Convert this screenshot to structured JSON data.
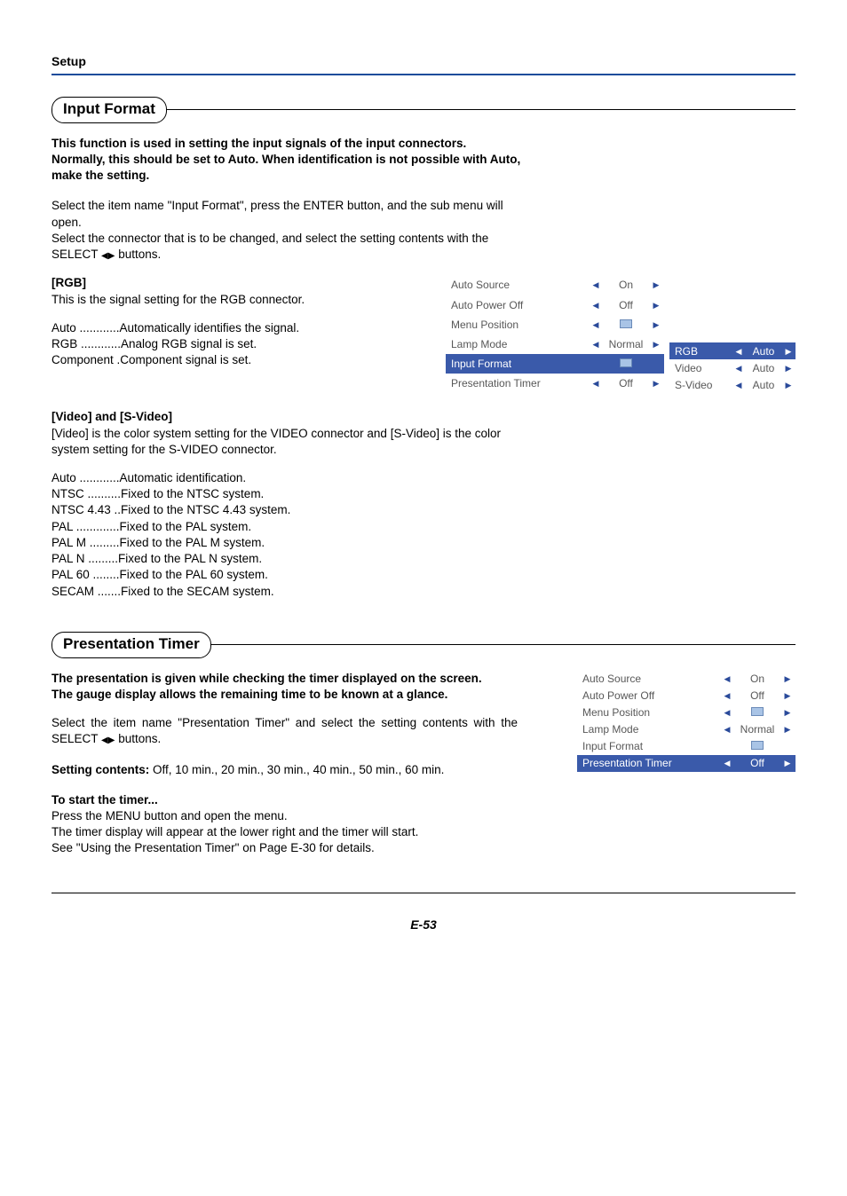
{
  "header": {
    "setup": "Setup"
  },
  "section1": {
    "title": "Input Format",
    "intro1": "This function is used in setting the input signals of the input connectors.",
    "intro2": "Normally, this should be set to Auto. When identification is not possible with Auto, make the setting.",
    "inst1_a": "Select the item name \"Input Format\", press the ENTER button, and the sub menu will open.",
    "inst2_a": "Select the connector that is to be changed, and select the setting contents with the SELECT ",
    "inst2_b": " buttons.",
    "rgb_heading": "[RGB]",
    "rgb_desc": "This is the signal setting for the RGB connector.",
    "rgb_defs": [
      {
        "label": "Auto",
        "dots": "............",
        "text": "Automatically identifies the signal."
      },
      {
        "label": "RGB",
        "dots": "............",
        "text": "Analog RGB signal is set."
      },
      {
        "label": "Component",
        "dots": ".",
        "text": "Component signal is set."
      }
    ],
    "video_heading": "[Video] and [S-Video]",
    "video_desc": "[Video] is the color system setting for the VIDEO connector and [S-Video] is the color system setting for the S-VIDEO connector.",
    "video_defs": [
      {
        "label": "Auto",
        "dots": "............",
        "text": "Automatic identification."
      },
      {
        "label": "NTSC",
        "dots": "..........",
        "text": "Fixed to the NTSC system."
      },
      {
        "label": "NTSC 4.43",
        "dots": "..",
        "text": "Fixed to the NTSC 4.43 system."
      },
      {
        "label": "PAL",
        "dots": ".............",
        "text": "Fixed to the PAL system."
      },
      {
        "label": "PAL M",
        "dots": ".........",
        "text": "Fixed to the PAL M system."
      },
      {
        "label": "PAL N",
        "dots": ".........",
        "text": "Fixed to the PAL N system."
      },
      {
        "label": "PAL 60",
        "dots": "........",
        "text": "Fixed to the PAL 60 system."
      },
      {
        "label": "SECAM",
        "dots": ".......",
        "text": "Fixed to the SECAM system."
      }
    ],
    "main_menu": [
      {
        "label": "Auto Source",
        "value": "On",
        "left": true,
        "right": true,
        "highlight": false,
        "icon": false
      },
      {
        "label": "Auto Power Off",
        "value": "Off",
        "left": true,
        "right": true,
        "highlight": false,
        "icon": false
      },
      {
        "label": "Menu Position",
        "value": "",
        "left": true,
        "right": true,
        "highlight": false,
        "icon": true
      },
      {
        "label": "Lamp Mode",
        "value": "Normal",
        "left": true,
        "right": true,
        "highlight": false,
        "icon": false
      },
      {
        "label": "Input Format",
        "value": "",
        "left": false,
        "right": false,
        "highlight": true,
        "icon": true
      },
      {
        "label": "Presentation Timer",
        "value": "Off",
        "left": true,
        "right": true,
        "highlight": false,
        "icon": false
      }
    ],
    "sub_menu": [
      {
        "label": "RGB",
        "value": "Auto",
        "highlight": true
      },
      {
        "label": "Video",
        "value": "Auto",
        "highlight": false
      },
      {
        "label": "S-Video",
        "value": "Auto",
        "highlight": false
      }
    ]
  },
  "section2": {
    "title": "Presentation Timer",
    "intro1": "The presentation is given while checking the timer displayed on the screen.",
    "intro2": "The gauge display allows the remaining time to be known at a glance.",
    "inst1_a": "Select the item name \"Presentation Timer\" and select the setting contents with the SELECT ",
    "inst1_b": " buttons.",
    "setting_label": "Setting contents:",
    "setting_values": " Off, 10 min., 20 min., 30 min., 40 min., 50 min., 60 min.",
    "start_heading": "To start the timer...",
    "start_l1": "Press the MENU button and open the menu.",
    "start_l2": "The timer display will appear at the lower right and the timer will start.",
    "start_l3": "See \"Using the Presentation Timer\" on Page E-30 for details.",
    "menu": [
      {
        "label": "Auto Source",
        "value": "On",
        "left": true,
        "right": true,
        "highlight": false,
        "icon": false
      },
      {
        "label": "Auto Power Off",
        "value": "Off",
        "left": true,
        "right": true,
        "highlight": false,
        "icon": false
      },
      {
        "label": "Menu Position",
        "value": "",
        "left": true,
        "right": true,
        "highlight": false,
        "icon": true
      },
      {
        "label": "Lamp Mode",
        "value": "Normal",
        "left": true,
        "right": true,
        "highlight": false,
        "icon": false
      },
      {
        "label": "Input Format",
        "value": "",
        "left": false,
        "right": false,
        "highlight": false,
        "icon": true
      },
      {
        "label": "Presentation Timer",
        "value": "Off",
        "left": true,
        "right": true,
        "highlight": true,
        "icon": false
      }
    ]
  },
  "footer": {
    "page": "E-53"
  }
}
